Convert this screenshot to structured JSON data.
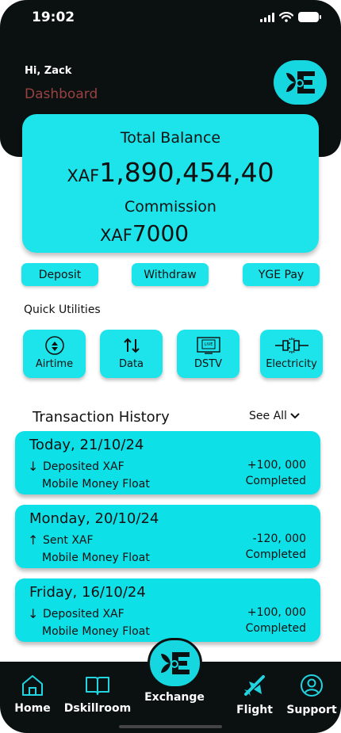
{
  "status_bar": {
    "time": "19:02"
  },
  "header": {
    "greeting": "Hi, Zack",
    "section": "Dashboard",
    "logo_icon": "yge-logo-icon"
  },
  "balance": {
    "total_label": "Total Balance",
    "total_currency": "XAF",
    "total_amount": "1,890,454,40",
    "commission_label": "Commission",
    "commission_currency": "XAF",
    "commission_amount": "7000"
  },
  "actions": {
    "deposit": "Deposit",
    "withdraw": "Withdraw",
    "yge_pay": "YGE Pay"
  },
  "quick_utilities": {
    "title": "Quick Utilities",
    "items": [
      {
        "label": "Airtime",
        "icon": "airtime-icon"
      },
      {
        "label": "Data",
        "icon": "data-arrows-icon"
      },
      {
        "label": "DSTV",
        "icon": "tv-icon"
      },
      {
        "label": "Electricity",
        "icon": "plug-icon"
      }
    ]
  },
  "transactions": {
    "title": "Transaction History",
    "see_all": "See All",
    "items": [
      {
        "date": "Today, 21/10/24",
        "arrow": "↓",
        "type": "Deposited XAF",
        "source": "Mobile Money Float",
        "amount": "+100, 000",
        "status": "Completed"
      },
      {
        "date": "Monday, 20/10/24",
        "arrow": "↑",
        "type": "Sent XAF",
        "source": "Mobile Money Float",
        "amount": "-120, 000",
        "status": "Completed"
      },
      {
        "date": "Friday, 16/10/24",
        "arrow": "↓",
        "type": "Deposited XAF",
        "source": "Mobile Money Float",
        "amount": "+100, 000",
        "status": "Completed"
      }
    ]
  },
  "bottom_nav": {
    "home": "Home",
    "dskillroom": "Dskillroom",
    "exchange": "Exchange",
    "flight": "Flight",
    "support": "Support"
  },
  "colors": {
    "accent": "#1de4ea",
    "dark": "#0b1111",
    "nav_icon": "#22d3e0",
    "dashboard_label": "#9a4141"
  }
}
